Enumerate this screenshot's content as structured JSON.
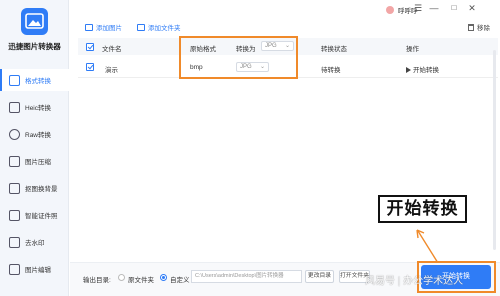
{
  "app": {
    "name": "迅捷图片转换器",
    "colors": {
      "accent": "#2f7cf6",
      "highlight": "#f08a2a"
    }
  },
  "sidebar": {
    "items": [
      {
        "label": "格式转换",
        "icon": "format-convert-icon",
        "active": true
      },
      {
        "label": "Heic转换",
        "icon": "heic-icon",
        "active": false
      },
      {
        "label": "Raw转换",
        "icon": "raw-icon",
        "active": false
      },
      {
        "label": "图片压缩",
        "icon": "compress-icon",
        "active": false
      },
      {
        "label": "抠图换背景",
        "icon": "cutout-icon",
        "active": false
      },
      {
        "label": "智能证件照",
        "icon": "id-photo-icon",
        "active": false
      },
      {
        "label": "去水印",
        "icon": "watermark-remove-icon",
        "active": false
      },
      {
        "label": "图片编辑",
        "icon": "image-edit-icon",
        "active": false
      }
    ]
  },
  "titlebar": {
    "user_name": "呼呼呼",
    "controls": [
      "☰",
      "—",
      "□",
      "✕"
    ]
  },
  "toolbar": {
    "add_image": "添加图片",
    "add_folder": "添加文件夹",
    "remove": "移除"
  },
  "table": {
    "headers": {
      "name": "文件名",
      "original_format": "原始格式",
      "convert_to": "转换为",
      "convert_to_value": "JPG",
      "status": "转换状态",
      "action": "操作"
    },
    "rows": [
      {
        "name": "演示",
        "format": "bmp",
        "target": "JPG",
        "status": "待转换",
        "action": "开始转换"
      }
    ]
  },
  "callout": {
    "text": "开始转换"
  },
  "bottom": {
    "output_label": "输出目录:",
    "option_source": "原文件夹",
    "option_custom": "自定义",
    "path": "C:\\Users\\admin\\Desktop\\图片转换器",
    "change_dir": "更改目录",
    "open_folder": "打开文件夹",
    "start_button": "开始转换"
  },
  "watermark": "风易号 | 办公学术达人"
}
